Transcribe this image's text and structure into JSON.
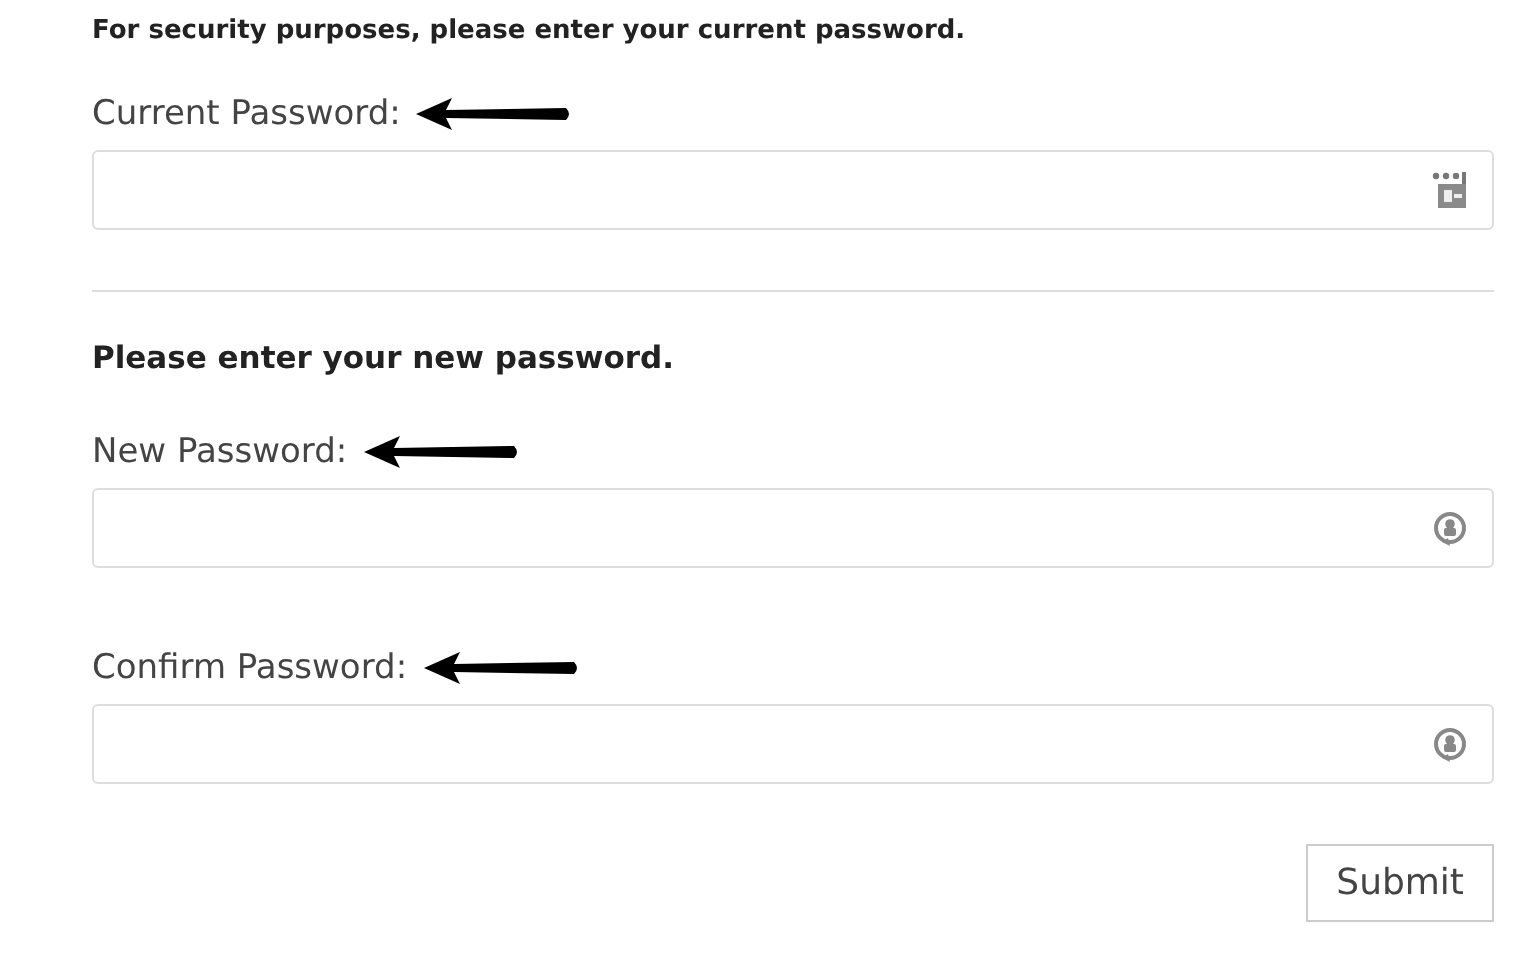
{
  "sections": [
    {
      "heading": "For security purposes, please enter your current password.",
      "fields": [
        {
          "label": "Current Password:",
          "kind": "keypad",
          "arrow": true
        }
      ]
    },
    {
      "heading": "Please enter your new password.",
      "fields": [
        {
          "label": "New Password:",
          "kind": "generator",
          "arrow": true
        },
        {
          "label": "Confirm Password:",
          "kind": "generator",
          "arrow": true
        }
      ]
    }
  ],
  "submit": "Submit"
}
